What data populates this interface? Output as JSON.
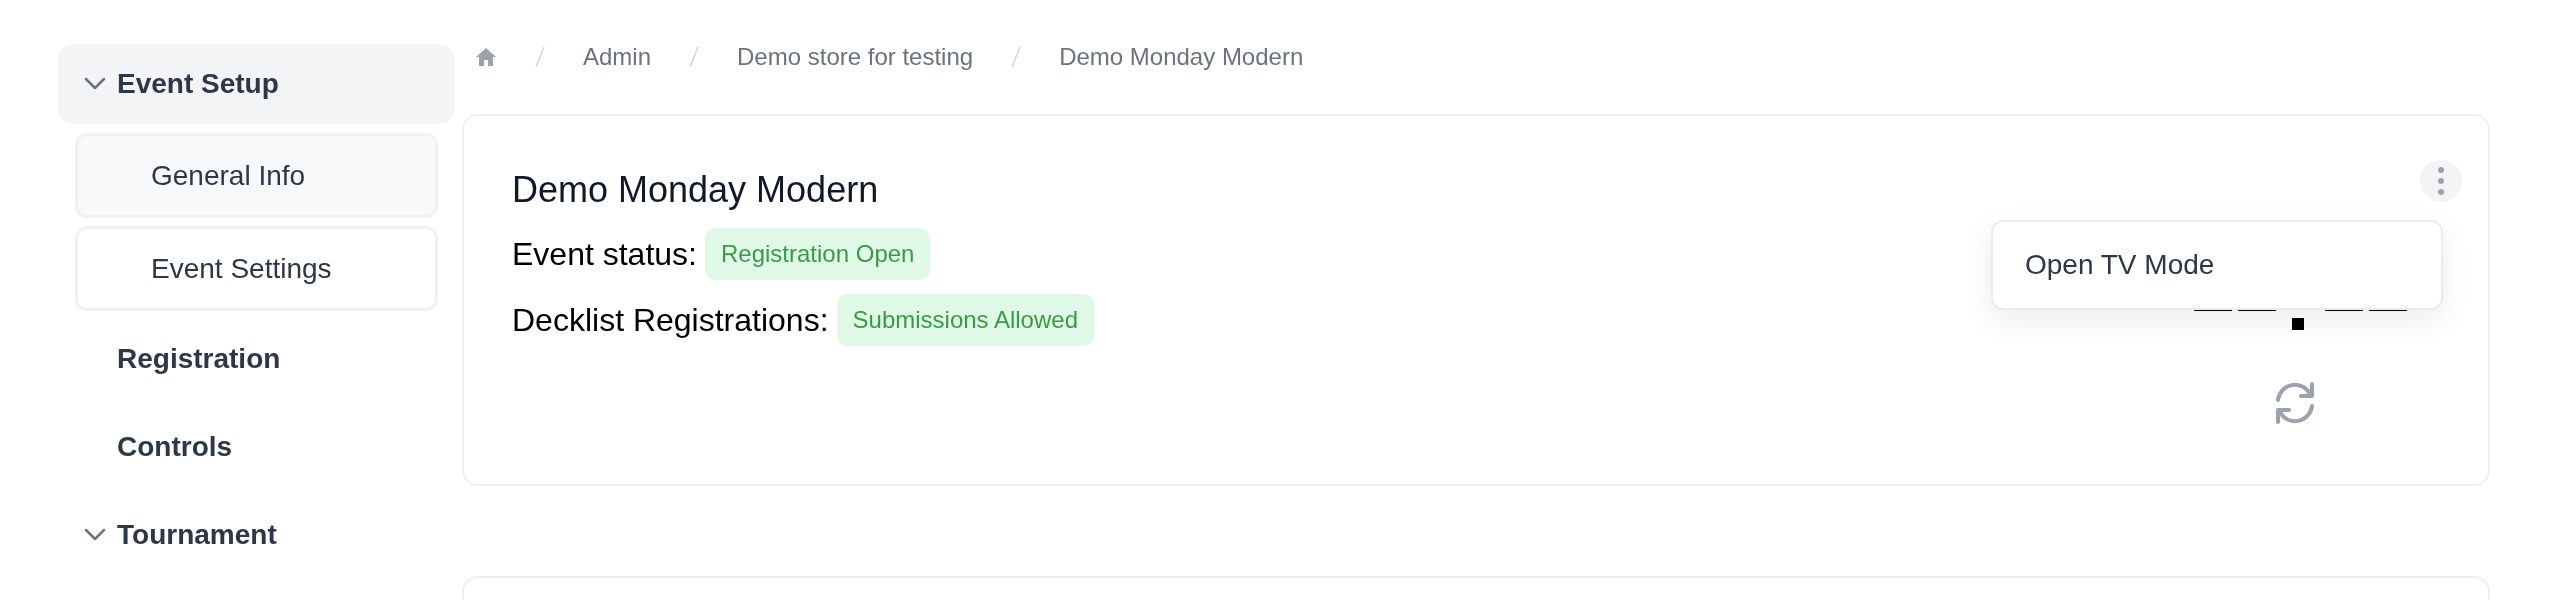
{
  "sidebar": {
    "items": [
      {
        "label": "Event Setup",
        "kind": "section",
        "expanded": true,
        "selected": true,
        "children": [
          {
            "label": "General Info",
            "selected": true
          },
          {
            "label": "Event Settings",
            "selected": false
          }
        ]
      },
      {
        "label": "Registration",
        "kind": "link",
        "selected": false
      },
      {
        "label": "Controls",
        "kind": "link",
        "selected": false
      },
      {
        "label": "Tournament",
        "kind": "section",
        "expanded": true,
        "selected": false
      }
    ]
  },
  "breadcrumbs": [
    "Admin",
    "Demo store for testing",
    "Demo Monday Modern"
  ],
  "event_card": {
    "title": "Demo Monday Modern",
    "statuses": [
      {
        "label": "Event status:",
        "value": "Registration Open"
      },
      {
        "label": "Decklist Registrations:",
        "value": "Submissions Allowed"
      }
    ],
    "menu": {
      "items": [
        "Open TV Mode"
      ]
    }
  }
}
